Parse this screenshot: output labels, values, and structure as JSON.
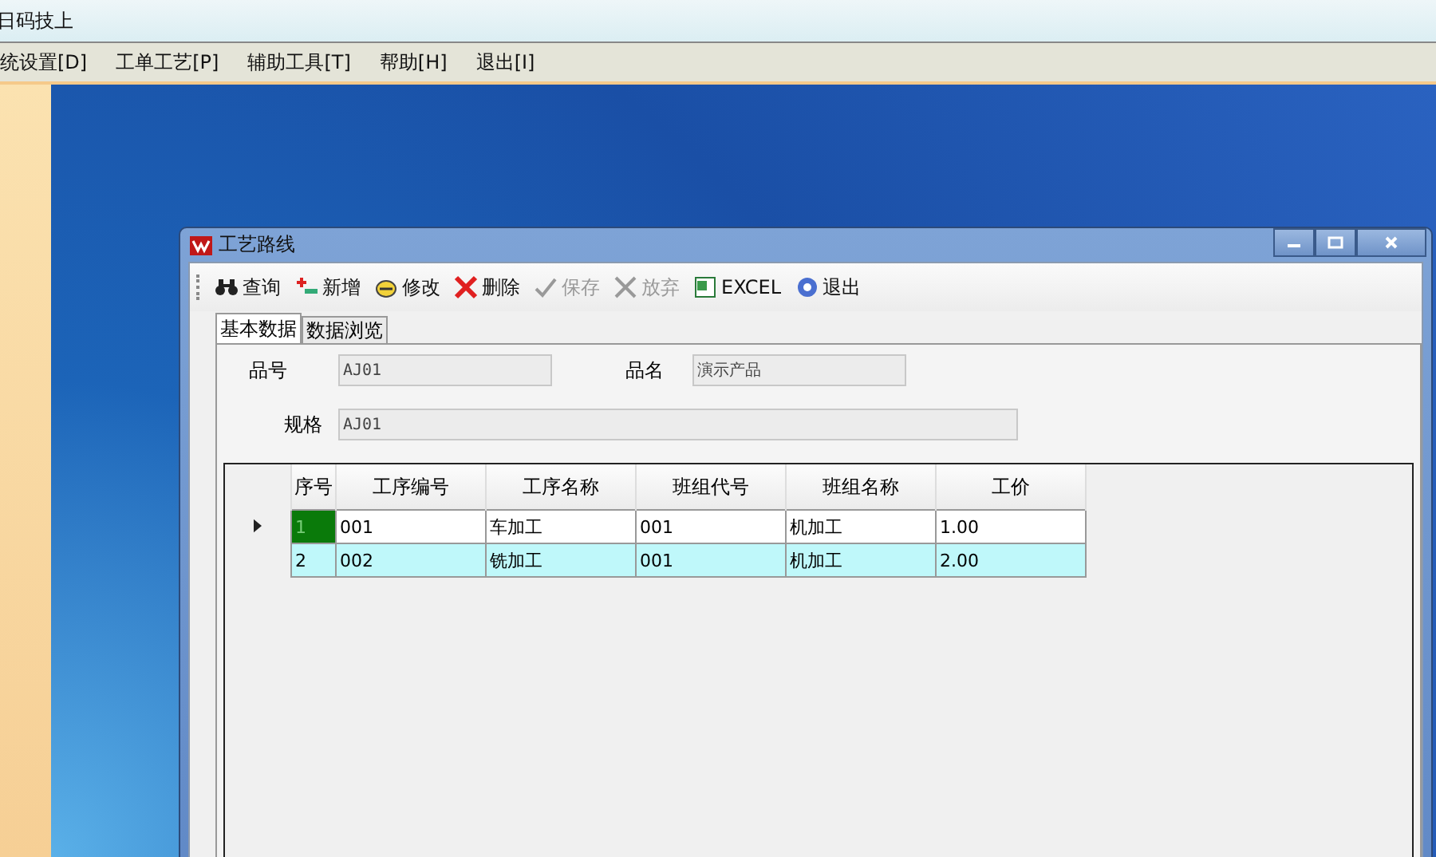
{
  "top_bar": {
    "title": "日码技上"
  },
  "menu_bar": {
    "items": [
      {
        "label": "统设置[D]"
      },
      {
        "label": "工单工艺[P]"
      },
      {
        "label": "辅助工具[T]"
      },
      {
        "label": "帮助[H]"
      },
      {
        "label": "退出[I]"
      }
    ]
  },
  "window": {
    "title": "工艺路线",
    "toolbar": [
      {
        "kind": "binoculars",
        "label": "查询",
        "disabled": false
      },
      {
        "kind": "add",
        "label": "新增",
        "disabled": false
      },
      {
        "kind": "edit",
        "label": "修改",
        "disabled": false
      },
      {
        "kind": "delete",
        "label": "删除",
        "disabled": false
      },
      {
        "kind": "check",
        "label": "保存",
        "disabled": true
      },
      {
        "kind": "cancel",
        "label": "放弃",
        "disabled": true
      },
      {
        "kind": "sheet",
        "label": "EXCEL",
        "disabled": false
      },
      {
        "kind": "exit",
        "label": "退出",
        "disabled": false
      }
    ],
    "tabs": [
      {
        "label": "基本数据",
        "selected": true
      },
      {
        "label": "数据浏览",
        "selected": false
      }
    ],
    "fields": [
      {
        "label": "品号",
        "value": "AJ01"
      },
      {
        "label": "品名",
        "value": "演示产品"
      },
      {
        "label": "规格",
        "value": "AJ01"
      }
    ],
    "table": {
      "columns": [
        "序号",
        "工序编号",
        "工序名称",
        "班组代号",
        "班组名称",
        "工价"
      ],
      "rows": [
        {
          "current": true,
          "selected": false,
          "cells": [
            "1",
            "001",
            "车加工",
            "001",
            "机加工",
            "1.00"
          ]
        },
        {
          "current": false,
          "selected": true,
          "cells": [
            "2",
            "002",
            "铣加工",
            "001",
            "机加工",
            "2.00"
          ]
        }
      ]
    }
  }
}
